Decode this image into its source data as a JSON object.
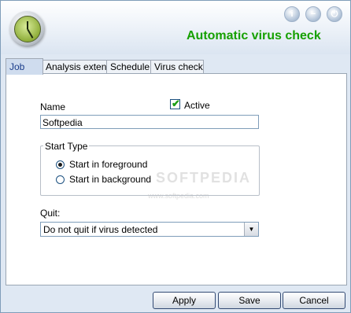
{
  "header": {
    "title": "Automatic virus check",
    "info_icon": "i",
    "minimize_icon": "−",
    "power_icon": "⏻"
  },
  "tabs": [
    {
      "label": "Job"
    },
    {
      "label": "Analysis extent"
    },
    {
      "label": "Schedule"
    },
    {
      "label": "Virus check"
    }
  ],
  "form": {
    "name_label": "Name",
    "name_value": "Softpedia",
    "active_label": "Active",
    "active_checked": true,
    "start_type_label": "Start Type",
    "start_options": [
      {
        "label": "Start in foreground",
        "selected": true
      },
      {
        "label": "Start in background",
        "selected": false
      }
    ],
    "quit_label": "Quit:",
    "quit_value": "Do not quit if virus detected"
  },
  "watermark": {
    "main": "SOFTPEDIA",
    "sub": "www.softpedia.com"
  },
  "footer": {
    "apply": "Apply",
    "save": "Save",
    "cancel": "Cancel"
  },
  "colors": {
    "title": "#16a000",
    "window_bg": "#dfe8f3"
  }
}
